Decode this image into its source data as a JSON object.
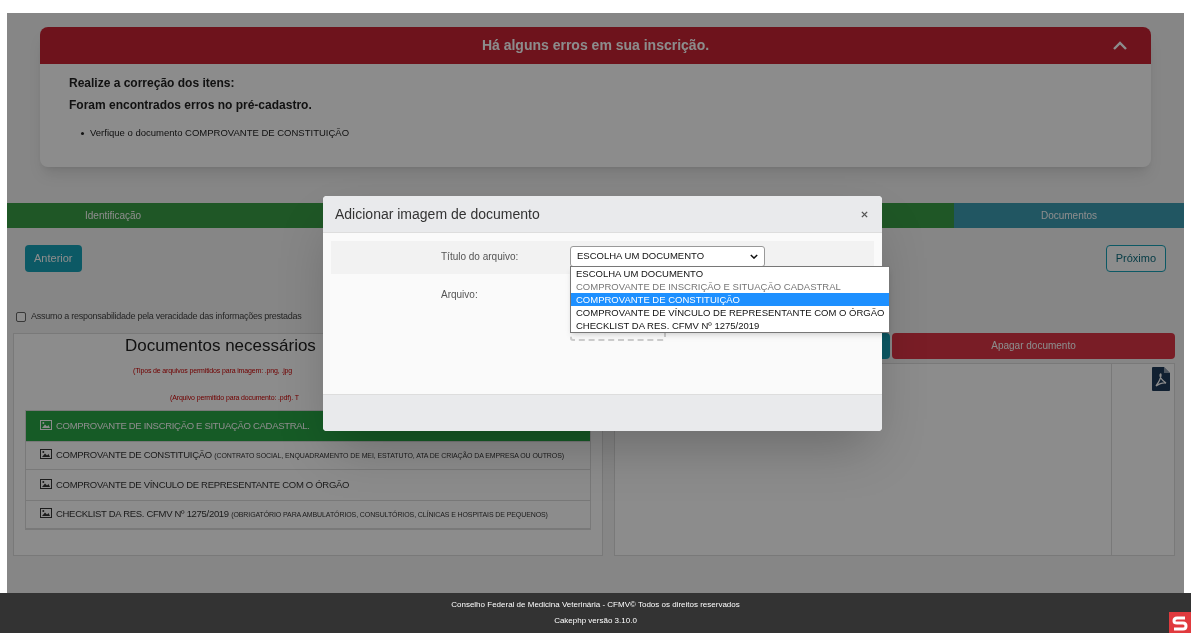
{
  "alert": {
    "title": "Há alguns erros em sua inscrição.",
    "expanded": true,
    "lines": [
      "Realize a correção dos itens:",
      "Foram encontrados erros no pré-cadastro."
    ],
    "items": [
      "Verfique o documento COMPROVANTE DE CONSTITUIÇÃO"
    ]
  },
  "steps": [
    {
      "label": "Identificação",
      "current": false
    },
    {
      "label": "Documentos",
      "current": true
    }
  ],
  "nav": {
    "previous": "Anterior",
    "next": "Próximo",
    "next_disabled": true
  },
  "agreement": {
    "label": "Assumo a responsabilidade pela veracidade das informações prestadas",
    "checked": false
  },
  "documents": {
    "title": "Documentos necessários",
    "notes": [
      "(Tipos de arquivos permitidos para imagem: .png, .jpg",
      "(Arquivo permitido para documento: .pdf). T"
    ],
    "items": [
      {
        "name": "COMPROVANTE DE INSCRIÇÃO E SITUAÇÃO CADASTRAL.",
        "selected": true
      },
      {
        "name": "COMPROVANTE DE CONSTITUIÇÃO",
        "detail": "(CONTRATO SOCIAL, ENQUADRAMENTO DE MEI, ESTATUTO, ATA DE CRIAÇÃO DA EMPRESA OU OUTROS)",
        "selected": false
      },
      {
        "name": "COMPROVANTE DE VÍNCULO DE REPRESENTANTE COM O ÓRGÃO",
        "selected": false
      },
      {
        "name": "CHECKLIST DA RES. CFMV Nº 1275/2019",
        "detail": "(OBRIGATÓRIO PARA AMBULATÓRIOS, CONSULTÓRIOS, CLÍNICAS E HOSPITAIS DE PEQUENOS)",
        "selected": false
      }
    ]
  },
  "preview": {
    "delete_button": "Apagar documento"
  },
  "modal": {
    "title": "Adicionar imagem de documento",
    "fields": [
      {
        "kind": "select",
        "label": "Título do arquivo:",
        "value": "ESCOLHA UM DOCUMENTO",
        "expanded": true,
        "options": [
          {
            "label": "ESCOLHA UM DOCUMENTO",
            "disabled": false,
            "highlighted": false
          },
          {
            "label": "COMPROVANTE DE INSCRIÇÃO E SITUAÇÃO CADASTRAL",
            "disabled": true,
            "highlighted": false
          },
          {
            "label": "COMPROVANTE DE CONSTITUIÇÃO",
            "disabled": false,
            "highlighted": true
          },
          {
            "label": "COMPROVANTE DE VÍNCULO DE REPRESENTANTE COM O ÓRGÃO",
            "disabled": false,
            "highlighted": false
          },
          {
            "label": "CHECKLIST DA RES. CFMV Nº 1275/2019",
            "disabled": false,
            "highlighted": false
          }
        ]
      },
      {
        "kind": "dropzone",
        "label": "Arquivo:"
      }
    ]
  },
  "footer": {
    "lines": [
      "Conselho Federal de Medicina Veterinária - CFMV© Todos os direitos reservados",
      "Cakephp versão 3.10.0"
    ]
  }
}
